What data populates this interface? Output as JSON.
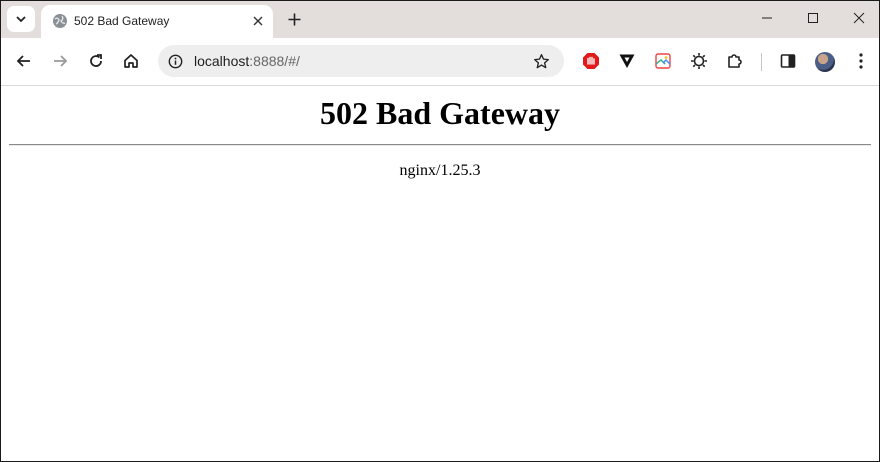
{
  "browser": {
    "tab": {
      "title": "502 Bad Gateway"
    },
    "address": {
      "host": "localhost",
      "rest": ":8888/#/"
    },
    "icons": [
      "tab-search-icon",
      "globe-favicon-icon",
      "close-icon",
      "plus-icon",
      "minimize-icon",
      "maximize-icon",
      "window-close-icon",
      "back-icon",
      "forward-icon",
      "reload-icon",
      "home-icon",
      "info-icon",
      "star-icon",
      "adblock-extension-icon",
      "vpn-extension-icon",
      "photo-extension-icon",
      "sun-extension-icon",
      "puzzle-icon",
      "side-panel-icon",
      "more-icon"
    ]
  },
  "page": {
    "heading": "502 Bad Gateway",
    "server": "nginx/1.25.3"
  },
  "colors": {
    "tabstrip": "#e3dedb",
    "omnibox": "#eeeeee",
    "adblock_red": "#e11b1b"
  }
}
